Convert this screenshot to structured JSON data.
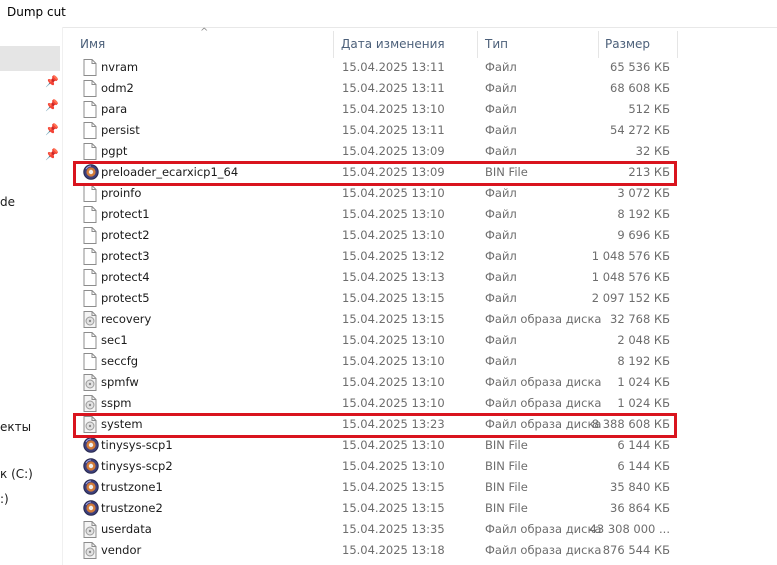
{
  "window": {
    "title": "Dump cut"
  },
  "nav_fragments": [
    "de",
    "екты",
    "к (C:)",
    ":)"
  ],
  "columns": {
    "name": "Имя",
    "date": "Дата изменения",
    "type": "Тип",
    "size": "Размер"
  },
  "sort_indicator": "^",
  "files": [
    {
      "name": "nvram",
      "date": "15.04.2025 13:11",
      "type": "Файл",
      "size": "65 536 КБ",
      "icon": "generic-file-icon"
    },
    {
      "name": "odm2",
      "date": "15.04.2025 13:11",
      "type": "Файл",
      "size": "68 608 КБ",
      "icon": "generic-file-icon"
    },
    {
      "name": "para",
      "date": "15.04.2025 13:10",
      "type": "Файл",
      "size": "512 КБ",
      "icon": "generic-file-icon"
    },
    {
      "name": "persist",
      "date": "15.04.2025 13:11",
      "type": "Файл",
      "size": "54 272 КБ",
      "icon": "generic-file-icon"
    },
    {
      "name": "pgpt",
      "date": "15.04.2025 13:09",
      "type": "Файл",
      "size": "32 КБ",
      "icon": "generic-file-icon"
    },
    {
      "name": "preloader_ecarxicp1_64",
      "date": "15.04.2025 13:09",
      "type": "BIN File",
      "size": "213 КБ",
      "icon": "bin-file-icon"
    },
    {
      "name": "proinfo",
      "date": "15.04.2025 13:10",
      "type": "Файл",
      "size": "3 072 КБ",
      "icon": "generic-file-icon"
    },
    {
      "name": "protect1",
      "date": "15.04.2025 13:10",
      "type": "Файл",
      "size": "8 192 КБ",
      "icon": "generic-file-icon"
    },
    {
      "name": "protect2",
      "date": "15.04.2025 13:10",
      "type": "Файл",
      "size": "9 696 КБ",
      "icon": "generic-file-icon"
    },
    {
      "name": "protect3",
      "date": "15.04.2025 13:12",
      "type": "Файл",
      "size": "1 048 576 КБ",
      "icon": "generic-file-icon"
    },
    {
      "name": "protect4",
      "date": "15.04.2025 13:13",
      "type": "Файл",
      "size": "1 048 576 КБ",
      "icon": "generic-file-icon"
    },
    {
      "name": "protect5",
      "date": "15.04.2025 13:15",
      "type": "Файл",
      "size": "2 097 152 КБ",
      "icon": "generic-file-icon"
    },
    {
      "name": "recovery",
      "date": "15.04.2025 13:15",
      "type": "Файл образа диска",
      "size": "32 768 КБ",
      "icon": "disk-image-icon"
    },
    {
      "name": "sec1",
      "date": "15.04.2025 13:10",
      "type": "Файл",
      "size": "2 048 КБ",
      "icon": "generic-file-icon"
    },
    {
      "name": "seccfg",
      "date": "15.04.2025 13:10",
      "type": "Файл",
      "size": "8 192 КБ",
      "icon": "generic-file-icon"
    },
    {
      "name": "spmfw",
      "date": "15.04.2025 13:10",
      "type": "Файл образа диска",
      "size": "1 024 КБ",
      "icon": "disk-image-icon"
    },
    {
      "name": "sspm",
      "date": "15.04.2025 13:10",
      "type": "Файл образа диска",
      "size": "1 024 КБ",
      "icon": "disk-image-icon"
    },
    {
      "name": "system",
      "date": "15.04.2025 13:23",
      "type": "Файл образа диска",
      "size": "8 388 608 КБ",
      "icon": "disk-image-icon"
    },
    {
      "name": "tinysys-scp1",
      "date": "15.04.2025 13:10",
      "type": "BIN File",
      "size": "6 144 КБ",
      "icon": "bin-file-icon"
    },
    {
      "name": "tinysys-scp2",
      "date": "15.04.2025 13:10",
      "type": "BIN File",
      "size": "6 144 КБ",
      "icon": "bin-file-icon"
    },
    {
      "name": "trustzone1",
      "date": "15.04.2025 13:15",
      "type": "BIN File",
      "size": "35 840 КБ",
      "icon": "bin-file-icon"
    },
    {
      "name": "trustzone2",
      "date": "15.04.2025 13:15",
      "type": "BIN File",
      "size": "36 864 КБ",
      "icon": "bin-file-icon"
    },
    {
      "name": "userdata",
      "date": "15.04.2025 13:35",
      "type": "Файл образа диска",
      "size": "43 308 000 ...",
      "icon": "disk-image-icon"
    },
    {
      "name": "vendor",
      "date": "15.04.2025 13:18",
      "type": "Файл образа диска",
      "size": "876 544 КБ",
      "icon": "disk-image-icon"
    }
  ],
  "highlighted_rows": [
    "preloader_ecarxicp1_64",
    "system"
  ],
  "colors": {
    "highlight": "#d9141e",
    "header_text": "#4c607a",
    "meta_text": "#6d6d6d"
  }
}
